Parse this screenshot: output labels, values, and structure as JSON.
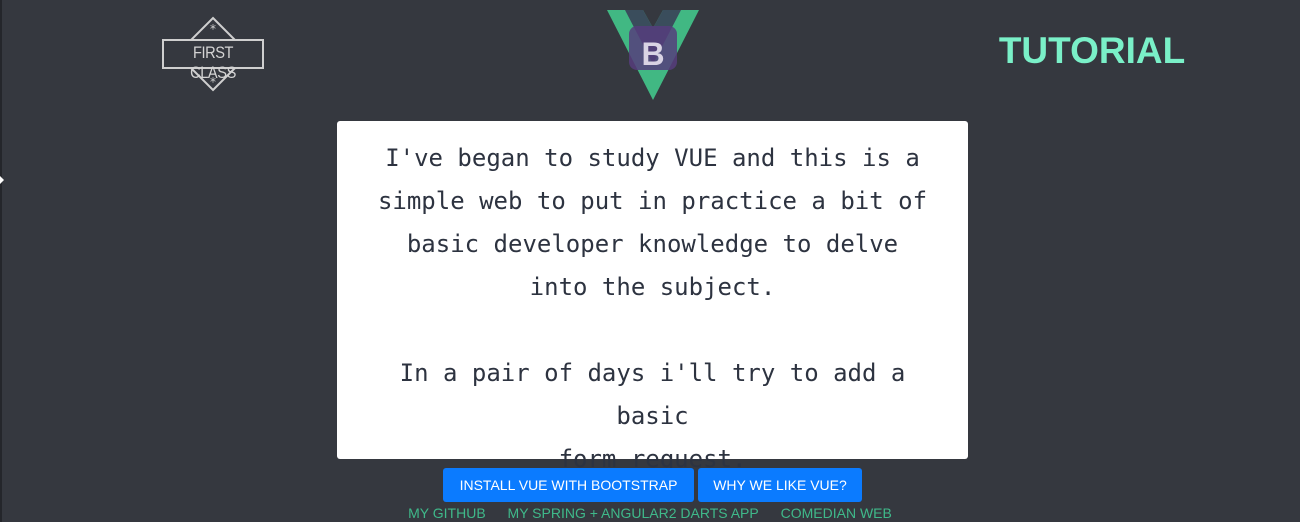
{
  "header": {
    "badge_text": "FIRST CLASS",
    "logo_letter": "B",
    "tutorial_label": "TUTORIAL"
  },
  "card": {
    "paragraph1_lines": [
      "I've began to study VUE and this is a",
      "simple web to put in practice a bit of",
      "basic developer knowledge to delve",
      "into the subject."
    ],
    "paragraph2_lines": [
      "In a pair of days i'll try to add a basic",
      "form request."
    ]
  },
  "buttons": {
    "install": "INSTALL VUE WITH BOOTSTRAP",
    "why": "WHY WE LIKE VUE?"
  },
  "links": {
    "github": "MY GITHUB",
    "spring": "MY SPRING + ANGULAR2 DARTS APP",
    "comedian": "COMEDIAN WEB"
  },
  "colors": {
    "background": "#35383f",
    "accent_mint": "#7af0c8",
    "link_green": "#3fb98a",
    "button_blue": "#0b7bff",
    "vue_green": "#41b883",
    "bootstrap_purple": "#563d7c"
  },
  "icons": {
    "badge": "first-class-badge-icon",
    "logo": "vue-bootstrap-logo-icon"
  }
}
